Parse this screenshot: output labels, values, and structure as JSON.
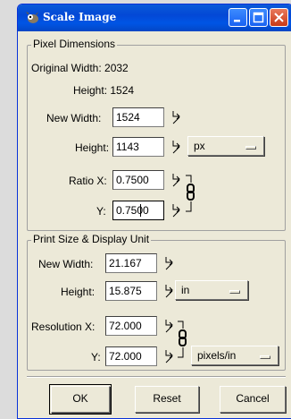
{
  "window": {
    "title": "Scale Image",
    "icon": "wilber-icon",
    "controls": [
      "minimize-icon",
      "maximize-icon",
      "close-icon"
    ]
  },
  "pixel_dimensions": {
    "legend": "Pixel Dimensions",
    "original_width_label": "Original Width: 2032",
    "original_height_label": "Height: 1524",
    "new_width_label": "New Width:",
    "new_width_value": "1524",
    "height_label": "Height:",
    "height_value": "1143",
    "unit": "px",
    "ratio_x_label": "Ratio X:",
    "ratio_x_value": "0.7500",
    "ratio_y_label": "Y:",
    "ratio_y_value": "0.7500"
  },
  "print_size": {
    "legend": "Print Size & Display Unit",
    "new_width_label": "New Width:",
    "new_width_value": "21.167",
    "height_label": "Height:",
    "height_value": "15.875",
    "unit": "in",
    "resolution_x_label": "Resolution X:",
    "resolution_x_value": "72.000",
    "resolution_y_label": "Y:",
    "resolution_y_value": "72.000",
    "resolution_unit": "pixels/in"
  },
  "buttons": {
    "ok": "OK",
    "reset": "Reset",
    "cancel": "Cancel"
  }
}
